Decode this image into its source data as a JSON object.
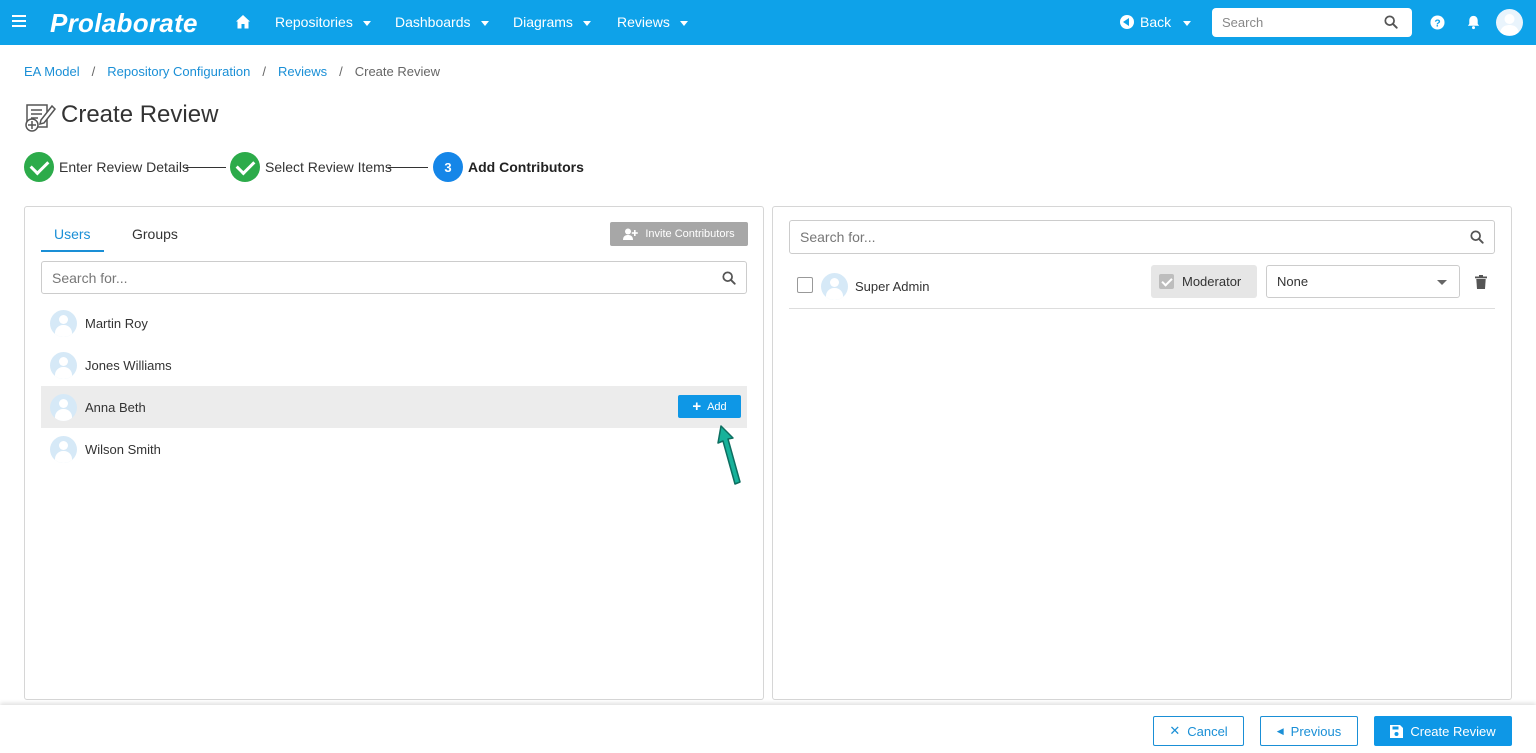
{
  "app": {
    "logo": "Prolaborate",
    "nav": [
      {
        "label": "Repositories"
      },
      {
        "label": "Dashboards"
      },
      {
        "label": "Diagrams"
      },
      {
        "label": "Reviews"
      }
    ],
    "back_label": "Back",
    "search_placeholder": "Search",
    "accent_color": "#0ea2e9"
  },
  "breadcrumb": {
    "items": [
      "EA Model",
      "Repository Configuration",
      "Reviews"
    ],
    "current": "Create Review",
    "separator": "/"
  },
  "page": {
    "title": "Create Review"
  },
  "steps": [
    {
      "label": "Enter Review Details",
      "status": "done"
    },
    {
      "label": "Select Review Items",
      "status": "done"
    },
    {
      "number": "3",
      "label": "Add Contributors",
      "status": "active"
    }
  ],
  "left_panel": {
    "tabs": [
      {
        "label": "Users",
        "active": true
      },
      {
        "label": "Groups",
        "active": false
      }
    ],
    "invite_label": "Invite Contributors",
    "search_placeholder": "Search for...",
    "users": [
      {
        "name": "Martin Roy"
      },
      {
        "name": "Jones Williams"
      },
      {
        "name": "Anna Beth"
      },
      {
        "name": "Wilson Smith"
      }
    ],
    "add_label": "Add"
  },
  "right_panel": {
    "search_placeholder": "Search for...",
    "contributors": [
      {
        "name": "Super Admin",
        "moderator_label": "Moderator",
        "role": "None"
      }
    ]
  },
  "footer": {
    "cancel_label": "Cancel",
    "previous_label": "Previous",
    "create_label": "Create Review"
  },
  "icons": [
    "hamburger-icon",
    "home-icon",
    "back-icon",
    "search-icon",
    "help-icon",
    "bell-icon",
    "user-avatar-icon",
    "edit-document-icon",
    "check-icon",
    "user-plus-icon",
    "plus-icon",
    "trash-icon",
    "close-icon",
    "chevron-left-icon",
    "save-icon"
  ]
}
